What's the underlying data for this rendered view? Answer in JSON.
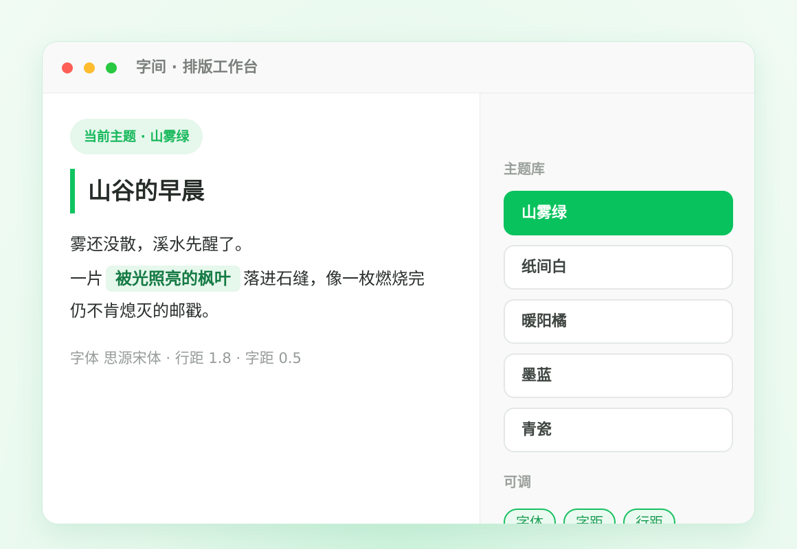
{
  "window": {
    "title": "字间 · 排版工作台"
  },
  "preview": {
    "theme_badge": "当前主题 · 山雾绿",
    "heading": "山谷的早晨",
    "line1": "雾还没散，溪水先醒了。",
    "line2_before": "一片",
    "line2_highlight": "被光照亮的枫叶",
    "line2_after": "落进石缝，像一枚燃烧完",
    "line3": "仍不肯熄灭的邮戳。",
    "meta": "字体 思源宋体 · 行距 1.8 · 字距 0.5"
  },
  "sidebar": {
    "library_label": "主题库",
    "themes": [
      {
        "label": "山雾绿",
        "active": true
      },
      {
        "label": "纸间白",
        "active": false
      },
      {
        "label": "暖阳橘",
        "active": false
      },
      {
        "label": "墨蓝",
        "active": false
      },
      {
        "label": "青瓷",
        "active": false
      }
    ],
    "adjust_label": "可调",
    "chips": [
      "字体",
      "字距",
      "行距"
    ]
  },
  "colors": {
    "accent": "#08c25d",
    "accent_soft": "#e6f7ec",
    "traffic_red": "#ff5f57",
    "traffic_yellow": "#febc2e",
    "traffic_green": "#28c840"
  }
}
